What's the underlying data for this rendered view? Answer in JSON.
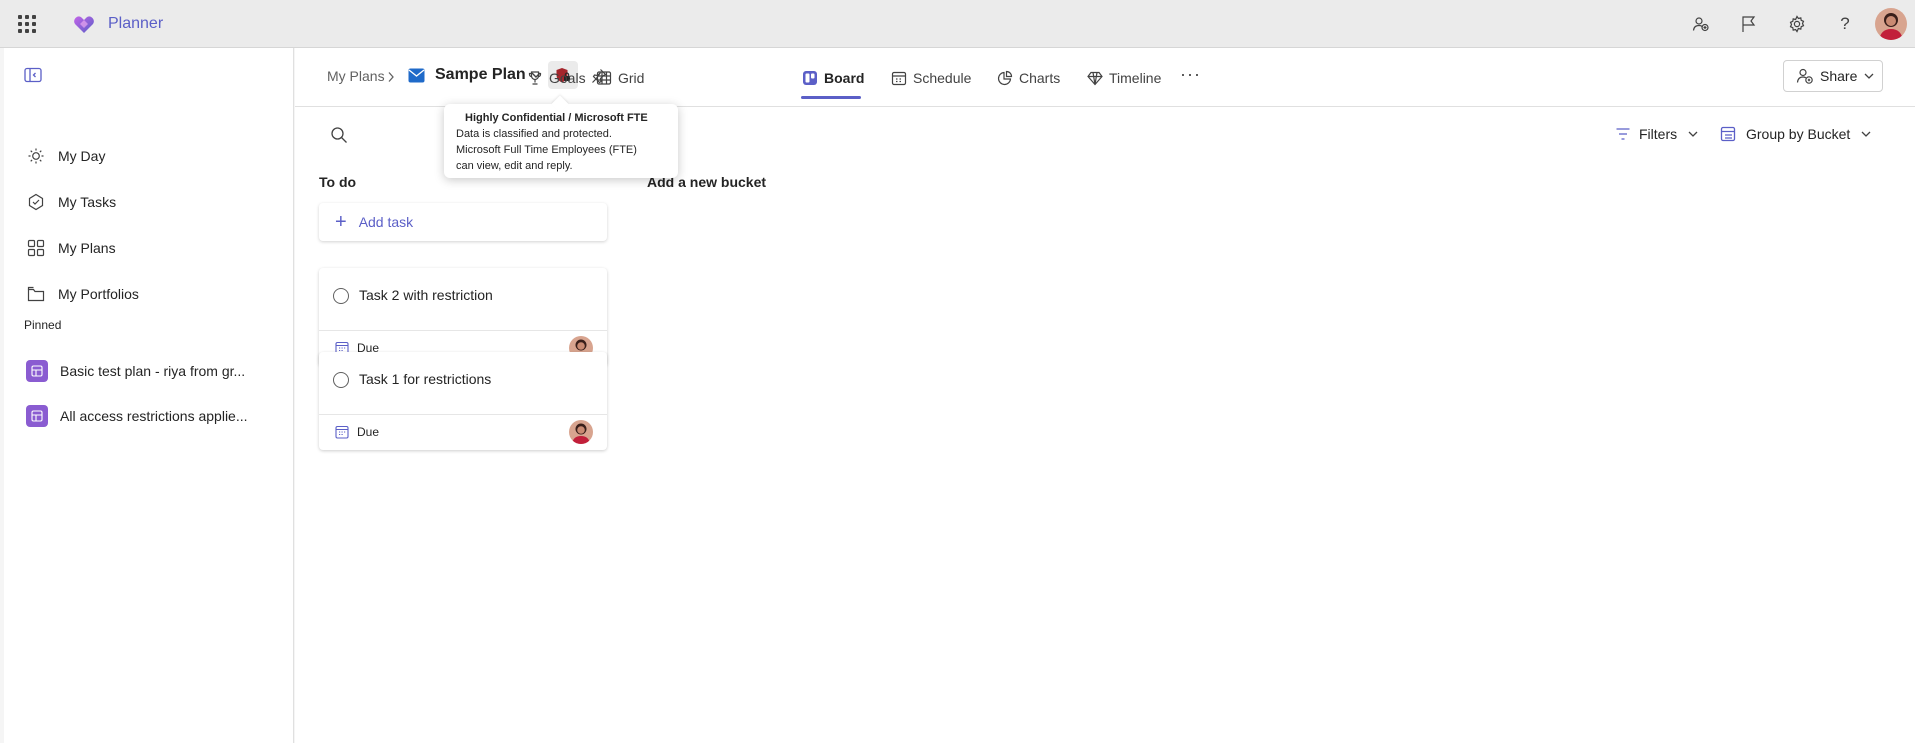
{
  "app": {
    "name": "Planner"
  },
  "topbar": {
    "icons": [
      "people-icon",
      "flag-icon",
      "gear-icon",
      "help-icon"
    ],
    "help_label": "?"
  },
  "sidebar": {
    "items": [
      {
        "label": "My Day",
        "icon": "sun-icon"
      },
      {
        "label": "My Tasks",
        "icon": "tasks-icon"
      },
      {
        "label": "My Plans",
        "icon": "grid-icon"
      },
      {
        "label": "My Portfolios",
        "icon": "folder-icon"
      }
    ],
    "pinned_label": "Pinned",
    "pinned": [
      {
        "label": "Basic test plan - riya from gr...",
        "color": "#8a5cd1"
      },
      {
        "label": "All access restrictions applie...",
        "color": "#8a5cd1"
      }
    ]
  },
  "header": {
    "breadcrumb": "My Plans",
    "plan_title": "Sampe Plan",
    "tabs": [
      {
        "label": "Goals",
        "icon": "trophy-icon"
      },
      {
        "label": "Grid",
        "icon": "table-icon"
      },
      {
        "label": "Board",
        "icon": "board-icon",
        "active": true
      },
      {
        "label": "Schedule",
        "icon": "calendar-icon"
      },
      {
        "label": "Charts",
        "icon": "chart-icon"
      },
      {
        "label": "Timeline",
        "icon": "diamond-icon"
      }
    ],
    "more_label": "···",
    "share_label": "Share"
  },
  "toolbar": {
    "filters_label": "Filters",
    "group_label": "Group by Bucket"
  },
  "tooltip": {
    "title": "Highly Confidential / Microsoft FTE",
    "body": "Data is classified and protected.\nMicrosoft Full Time Employees (FTE)\ncan view, edit and reply."
  },
  "board": {
    "bucket_name": "To do",
    "add_task_label": "Add task",
    "new_bucket_label": "Add a new bucket",
    "tasks": [
      {
        "title": "Task 2 with restriction",
        "due_label": "Due"
      },
      {
        "title": "Task 1 for restrictions",
        "due_label": "Due"
      }
    ]
  },
  "colors": {
    "accent": "#5b5fc7",
    "sensitivity": "#a4262c",
    "plan_badge": "#8a5cd1"
  }
}
